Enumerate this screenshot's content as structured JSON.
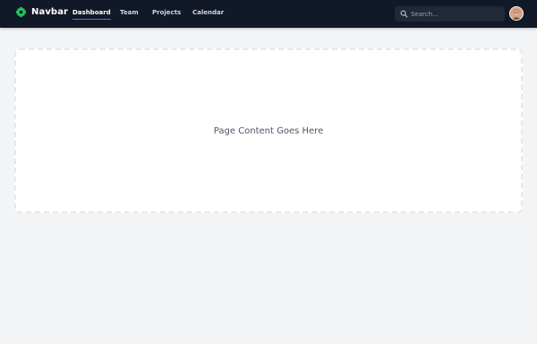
{
  "brand": {
    "name": "Navbar",
    "logo_icon": "flower-logo-icon",
    "logo_color": "#22c55e"
  },
  "nav": {
    "links": [
      {
        "label": "Dashboard",
        "active": true
      },
      {
        "label": "Team",
        "active": false
      },
      {
        "label": "Projects",
        "active": false
      },
      {
        "label": "Calendar",
        "active": false
      }
    ]
  },
  "search": {
    "placeholder": "Search...",
    "value": "",
    "icon": "search-icon"
  },
  "user": {
    "avatar": "avatar"
  },
  "main": {
    "placeholder_text": "Page Content Goes Here"
  },
  "colors": {
    "navbar_bg": "#111827",
    "page_bg": "#f3f4f6",
    "accent": "#6366f1",
    "search_bg": "#1f2937"
  }
}
